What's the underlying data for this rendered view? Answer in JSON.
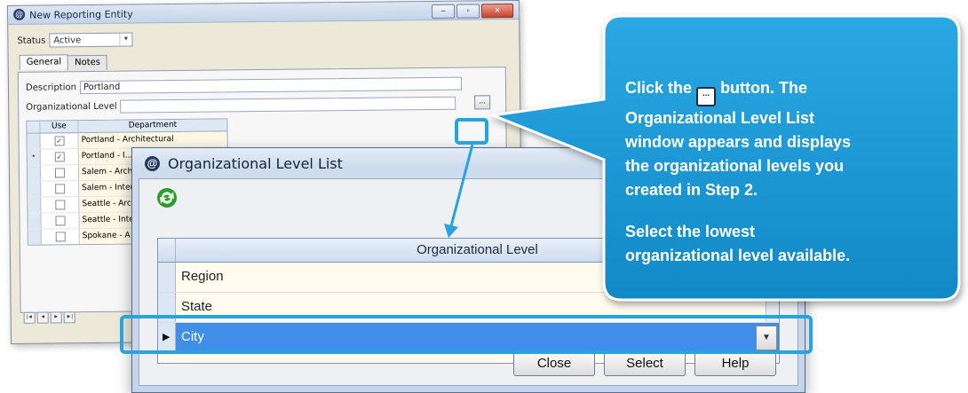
{
  "back_window": {
    "title": "New Reporting Entity",
    "status_label": "Status",
    "status_value": "Active",
    "tabs": [
      "General",
      "Notes"
    ],
    "description_label": "Description",
    "description_value": "Portland",
    "org_level_label": "Organizational Level",
    "org_level_value": "",
    "ellipsis_label": "...",
    "grid": {
      "columns": [
        "Use",
        "Department"
      ],
      "rows": [
        {
          "marker": "",
          "checked": true,
          "department": "Portland - Architectural"
        },
        {
          "marker": "*",
          "checked": true,
          "department": "Portland - I..."
        },
        {
          "marker": "",
          "checked": false,
          "department": "Salem - Arch"
        },
        {
          "marker": "",
          "checked": false,
          "department": "Salem - Inter"
        },
        {
          "marker": "",
          "checked": false,
          "department": "Seattle - Arc"
        },
        {
          "marker": "",
          "checked": false,
          "department": "Seattle - Inter"
        },
        {
          "marker": "",
          "checked": false,
          "department": "Spokane - A"
        }
      ]
    },
    "pager": [
      "|◄",
      "◄",
      "►",
      "►|"
    ]
  },
  "dialog": {
    "title": "Organizational Level List",
    "column_header": "Organizational Level",
    "rows": [
      {
        "label": "Region",
        "selected": false
      },
      {
        "label": "State",
        "selected": false
      },
      {
        "label": "City",
        "selected": true
      }
    ],
    "buttons": {
      "close": "Close",
      "select": "Select",
      "help": "Help"
    }
  },
  "callout": {
    "line1_pre": "Click the",
    "line1_post": "button. The",
    "line2": "Organizational Level List",
    "line3": "window appears and displays",
    "line4": "the organizational levels you",
    "line5": "created in Step 2.",
    "line6": "Select the lowest",
    "line7": "organizational level available."
  },
  "colors": {
    "callout_bg": "#1c9ad6",
    "highlight": "#29a3dd",
    "selected_row": "#3f8fe8"
  }
}
